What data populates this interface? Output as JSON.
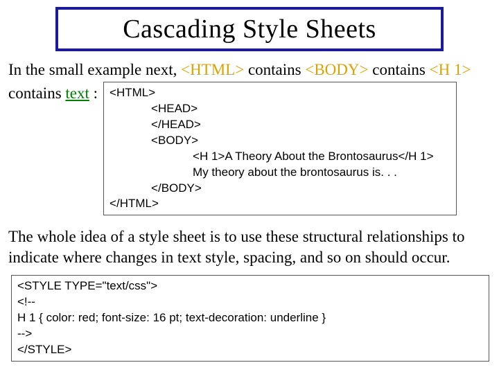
{
  "title": "Cascading Style Sheets",
  "intro": {
    "pre1": "In the small example next, ",
    "tag1": "<HTML>",
    "mid1": " contains ",
    "tag2": "<BODY>",
    "mid2": " contains ",
    "tag3": "<H 1>",
    "pre2": "contains ",
    "kw": "text",
    "post2": " :"
  },
  "code1": {
    "l1": "<HTML>",
    "l2": "<HEAD>",
    "l3": "</HEAD>",
    "l4": "<BODY>",
    "l5": "<H 1>A Theory About the Brontosaurus</H 1>",
    "l6": "My theory about the brontosaurus is. . .",
    "l7": "</BODY>",
    "l8": "</HTML>"
  },
  "para": "The whole idea of a style sheet is to use these structural relationships to indicate where changes in text style, spacing, and so on should occur.",
  "code2": {
    "l1": "<STYLE TYPE=\"text/css\">",
    "l2": "<!--",
    "l3": "H 1 { color: red; font-size: 16 pt; text-decoration: underline }",
    "l4": "-->",
    "l5": "</STYLE>"
  }
}
